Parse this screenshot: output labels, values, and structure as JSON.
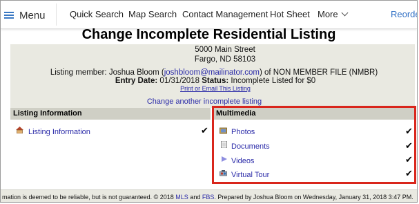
{
  "nav": {
    "menu_label": "Menu",
    "items": [
      "Quick Search",
      "Map Search",
      "Contact Management",
      "Hot Sheet",
      "More"
    ],
    "reorder_label": "Reorde"
  },
  "page": {
    "title": "Change Incomplete Residential Listing",
    "address_line1": "5000 Main Street",
    "address_line2": "Fargo, ND 58103",
    "member_prefix": "Listing member: Joshua Bloom (",
    "member_email": "joshbloom@mailinator.com",
    "member_suffix": ") of NON MEMBER FILE (NMBR)",
    "entry_date_label": "Entry Date:",
    "entry_date_value": "01/31/2018",
    "status_label": "Status:",
    "status_value": "Incomplete",
    "listed_for": "Listed for $0",
    "print_email_link": "Print or Email This Listing",
    "change_another_link": "Change another incomplete listing"
  },
  "listing_information": {
    "header": "Listing Information",
    "items": [
      {
        "label": "Listing Information",
        "icon": "house-icon",
        "checked": true
      }
    ]
  },
  "multimedia": {
    "header": "Multimedia",
    "items": [
      {
        "label": "Photos",
        "icon": "photo-icon",
        "checked": true
      },
      {
        "label": "Documents",
        "icon": "document-icon",
        "checked": true
      },
      {
        "label": "Videos",
        "icon": "video-icon",
        "checked": true
      },
      {
        "label": "Virtual Tour",
        "icon": "virtual-tour-icon",
        "checked": true
      }
    ]
  },
  "check_glyph": "✔",
  "footer": {
    "text_start": "mation is deemed to be reliable, but is not guaranteed. © 2018 ",
    "mls_link": "MLS",
    "and": " and ",
    "fbs_link": "FBS",
    "text_end": ". Prepared by Joshua Bloom on Wednesday, January 31, 2018 3:47 PM."
  },
  "colors": {
    "accent": "#2f6fc4",
    "link": "#2a2aa8",
    "highlight": "#d9261c",
    "panel": "#e9e9e1"
  }
}
